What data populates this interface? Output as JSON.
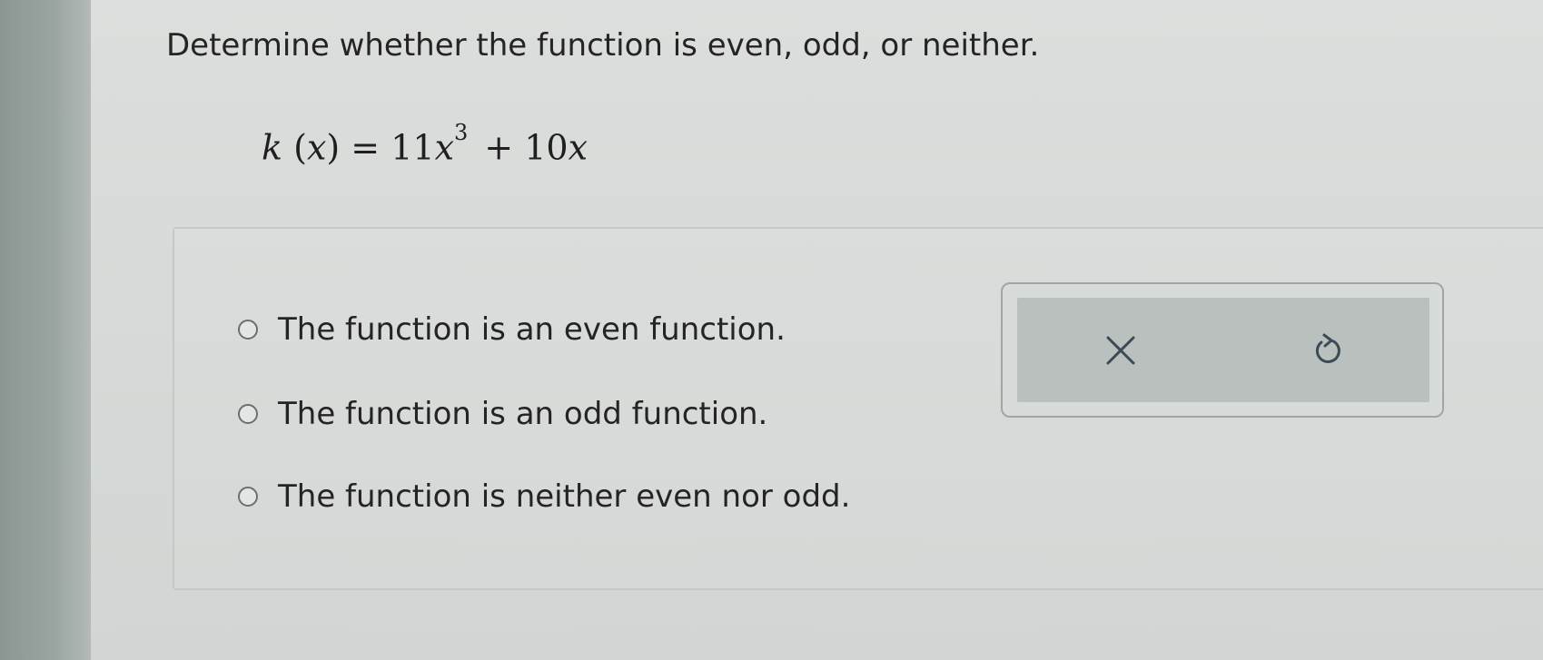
{
  "question": {
    "prompt": "Determine whether the function is even, odd, or neither.",
    "equation": {
      "name": "k",
      "lparen": "(",
      "arg": "x",
      "rparen": ")",
      "equals": " = ",
      "coefficient": "11",
      "variable": "x",
      "exponent": "3",
      "rest": "+ 10",
      "rest_var": "x"
    }
  },
  "options": [
    {
      "label": "The function is an even function.",
      "selected": false
    },
    {
      "label": "The function is an odd function.",
      "selected": false
    },
    {
      "label": "The function is neither even nor odd.",
      "selected": false
    }
  ],
  "tools": {
    "clear_icon": "close-icon",
    "reset_icon": "undo-icon"
  }
}
